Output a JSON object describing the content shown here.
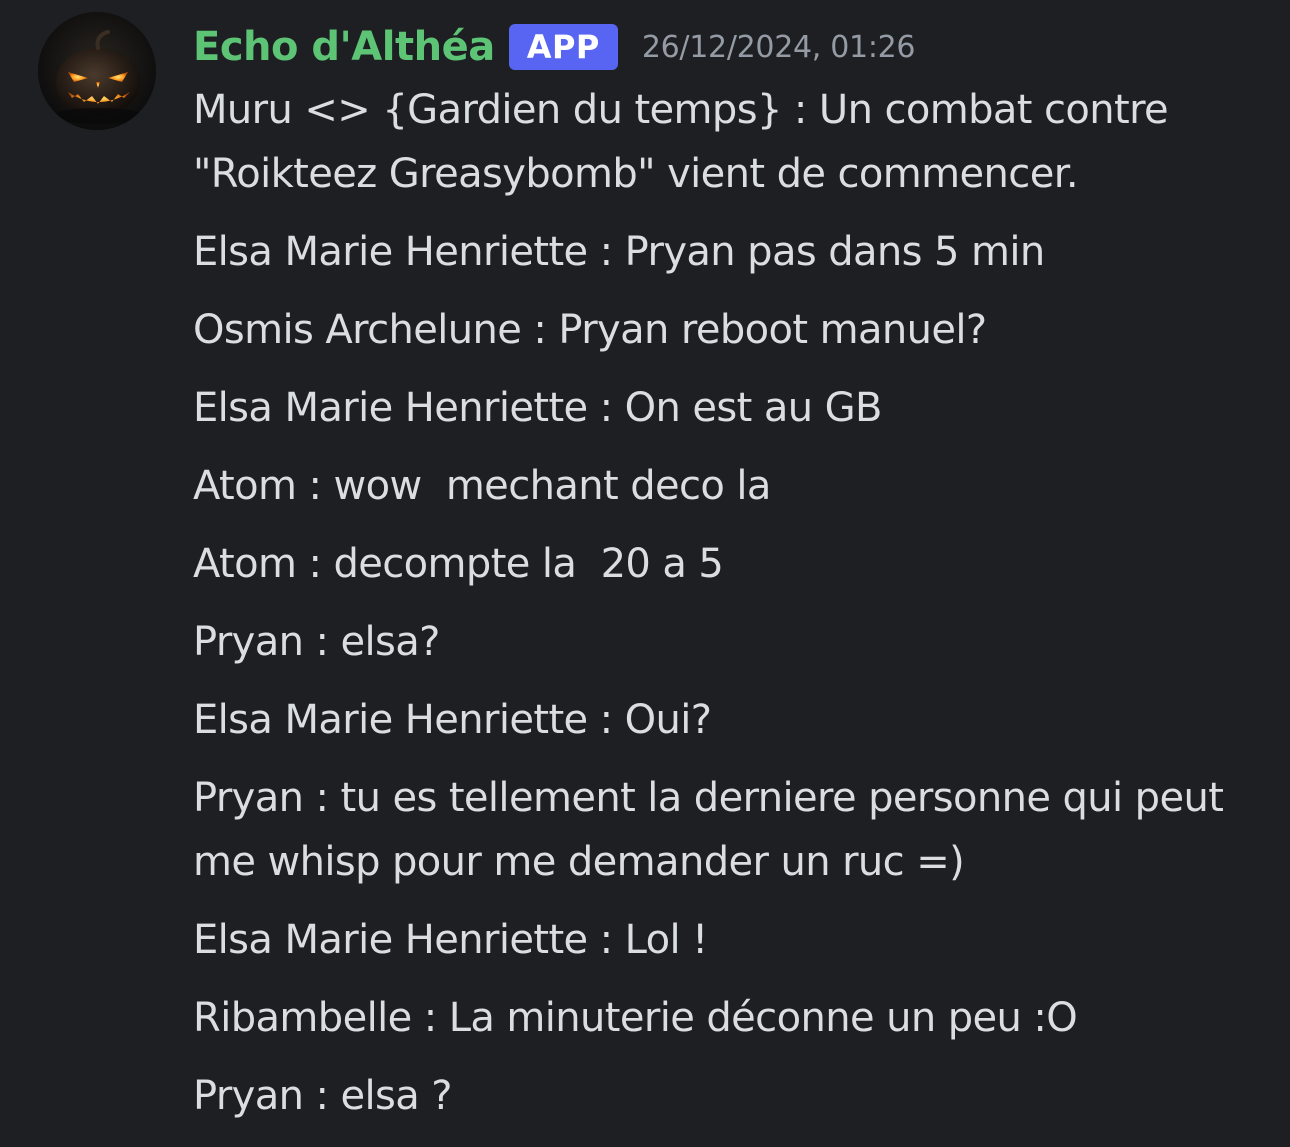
{
  "message": {
    "author": "Echo d'Althéa",
    "author_color": "#5dc476",
    "badge": "APP",
    "badge_color": "#5865f2",
    "timestamp": "26/12/2024, 01:26",
    "avatar_icon": "jack-o-lantern-icon",
    "lines": [
      "Muru <> {Gardien du temps} : Un combat contre \"Roikteez Greasybomb\" vient de commencer.",
      "Elsa Marie Henriette : Pryan pas dans 5 min",
      "Osmis Archelune : Pryan reboot manuel?",
      "Elsa Marie Henriette : On est au GB",
      "Atom : wow  mechant deco la",
      "Atom : decompte la  20 a 5",
      "Pryan : elsa?",
      "Elsa Marie Henriette : Oui?",
      "Pryan : tu es tellement la derniere personne qui peut me whisp pour me demander un ruc =)",
      "Elsa Marie Henriette : Lol !",
      "Ribambelle : La minuterie déconne un peu :O",
      "Pryan : elsa ?"
    ]
  }
}
